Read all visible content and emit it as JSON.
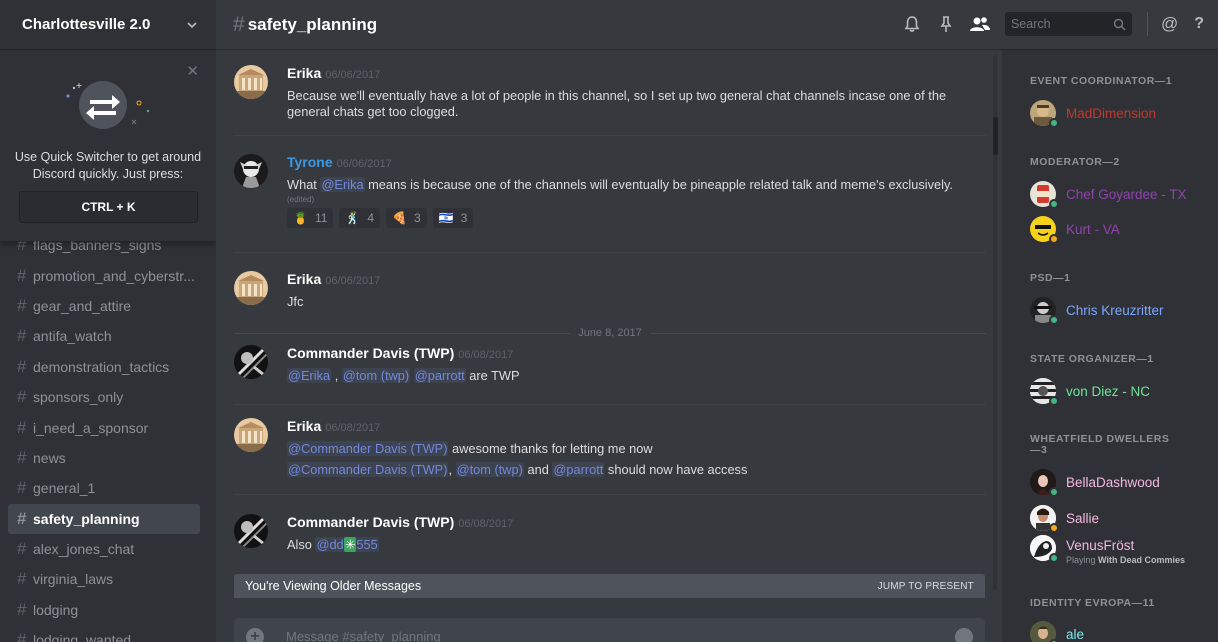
{
  "server": {
    "name": "Charlottesville 2.0"
  },
  "quick_switcher": {
    "text": "Use Quick Switcher to get around Discord quickly. Just press:",
    "shortcut": "CTRL + K"
  },
  "channels": [
    "flags_banners_signs",
    "promotion_and_cyberstr...",
    "gear_and_attire",
    "antifa_watch",
    "demonstration_tactics",
    "sponsors_only",
    "i_need_a_sponsor",
    "news",
    "general_1",
    "safety_planning",
    "alex_jones_chat",
    "virginia_laws",
    "lodging",
    "lodging_wanted"
  ],
  "active_channel": "safety_planning",
  "topbar": {
    "channel": "safety_planning",
    "search_placeholder": "Search",
    "at": "@",
    "help": "?"
  },
  "messages": [
    {
      "author": "Erika",
      "time": "06/06/2017",
      "text": "Because we'll eventually have a lot of people in this channel, so I set up two general chat channels incase one of the general chats get too clogged."
    },
    {
      "author": "Tyrone",
      "time": "06/06/2017",
      "pre": "What ",
      "mention": "@Erika",
      "post": " means is because one of the channels will eventually be pineapple related talk and meme's exclusively.",
      "edited": "(edited)",
      "reactions": [
        {
          "emoji": "🍍",
          "count": "11"
        },
        {
          "emoji": "🕺",
          "count": "4"
        },
        {
          "emoji": "🍕",
          "count": "3"
        },
        {
          "emoji": "🇮🇱",
          "count": "3"
        }
      ]
    },
    {
      "author": "Erika",
      "time": "06/06/2017",
      "text": "Jfc"
    },
    {
      "author": "Commander Davis (TWP)",
      "time": "06/08/2017",
      "m1": "@Erika",
      "sep": " , ",
      "m2": "@tom (twp)",
      "m3": "@parrott",
      "post": " are TWP"
    },
    {
      "author": "Erika",
      "time": "06/08/2017",
      "line1_mention": "@Commander Davis (TWP)",
      "line1_post": " awesome thanks for letting me now",
      "line2_m1": "@Commander Davis (TWP)",
      "line2_comma": ", ",
      "line2_m2": "@tom (twp)",
      "line2_and": " and ",
      "line2_m3": "@parrott",
      "line2_post": " should now have access"
    },
    {
      "author": "Commander Davis (TWP)",
      "time": "06/08/2017",
      "pre": "Also ",
      "mention_a": "@dd",
      "mention_emoji": "✳",
      "mention_b": "555"
    }
  ],
  "date_divider": "June 8, 2017",
  "older_bar": {
    "label": "You're Viewing Older Messages",
    "action": "JUMP TO PRESENT"
  },
  "composer": {
    "placeholder": "Message #safety_planning"
  },
  "member_groups": [
    {
      "role": "EVENT COORDINATOR—1",
      "members": [
        {
          "name": "MadDimension",
          "color": "#c0392b",
          "status": "online"
        }
      ]
    },
    {
      "role": "MODERATOR—2",
      "members": [
        {
          "name": "Chef Goyardee - TX",
          "color": "#8e44ad",
          "status": "online"
        },
        {
          "name": "Kurt - VA",
          "color": "#8e44ad",
          "status": "idle"
        }
      ]
    },
    {
      "role": "PSD—1",
      "members": [
        {
          "name": "Chris Kreuzritter",
          "color": "#7ba7ff",
          "status": "online"
        }
      ]
    },
    {
      "role": "STATE ORGANIZER—1",
      "members": [
        {
          "name": "von Diez - NC",
          "color": "#71e39a",
          "status": "online"
        }
      ]
    },
    {
      "role": "WHEATFIELD DWELLERS—3",
      "members": [
        {
          "name": "BellaDashwood",
          "color": "#f5b8e0",
          "status": "online"
        },
        {
          "name": "Sallie",
          "color": "#f5b8e0",
          "status": "idle"
        },
        {
          "name": "VenusFröst",
          "color": "#f5b8e0",
          "status": "online",
          "activity_prefix": "Playing ",
          "activity": "With Dead Commies"
        }
      ]
    },
    {
      "role": "IDENTITY EVROPA—11",
      "members": [
        {
          "name": "ale",
          "color": "#7ee7f0",
          "status": "online"
        }
      ]
    }
  ]
}
